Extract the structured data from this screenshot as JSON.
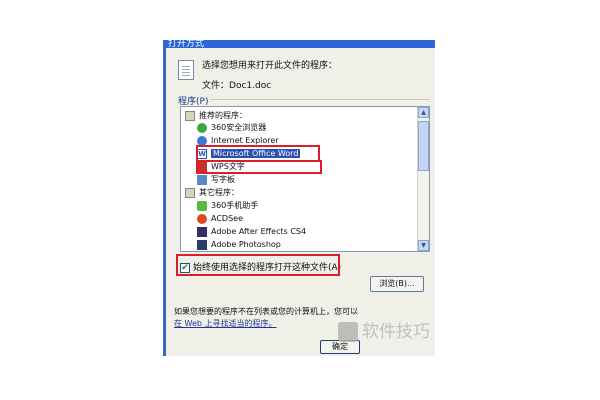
{
  "window": {
    "title": "打开方式"
  },
  "prompt": "选择您想用来打开此文件的程序：",
  "file": {
    "label": "文件：",
    "name": "Doc1.doc"
  },
  "programs_section": {
    "label": "程序(P)"
  },
  "programs": {
    "recommended_label": "推荐的程序：",
    "recommended": [
      {
        "label": "360安全浏览器",
        "icon": "360-browser-icon",
        "color": "#3aa83a"
      },
      {
        "label": "Internet Explorer",
        "icon": "internet-explorer-icon",
        "color": "#3a78d8"
      },
      {
        "label": "Microsoft Office Word",
        "icon": "word-icon",
        "color": "#2a52be",
        "selected": true
      },
      {
        "label": "WPS文字",
        "icon": "wps-icon",
        "color": "#c8322a"
      },
      {
        "label": "写字板",
        "icon": "wordpad-icon",
        "color": "#5a88c8"
      }
    ],
    "other_label": "其它程序：",
    "other": [
      {
        "label": "360手机助手",
        "icon": "360-phone-assistant-icon",
        "color": "#5ab83a"
      },
      {
        "label": "ACDSee",
        "icon": "acdsee-icon",
        "color": "#d84a1a"
      },
      {
        "label": "Adobe After Effects CS4",
        "icon": "after-effects-icon",
        "color": "#3a2a6a"
      },
      {
        "label": "Adobe Photoshop",
        "icon": "photoshop-icon",
        "color": "#2a3a6a"
      }
    ]
  },
  "always_use": {
    "label": "始终使用选择的程序打开这种文件(A)",
    "checked": true
  },
  "browse_button": "浏览(B)...",
  "bottom": {
    "hint": "如果您想要的程序不在列表或您的计算机上，您可以",
    "link": "在 Web 上寻找适当的程序。"
  },
  "ok_button": "确定",
  "watermark": "软件技巧",
  "colors": {
    "highlight": "#d8202a",
    "selection": "#2c4fb0",
    "titlebar": "#2e65d8"
  }
}
